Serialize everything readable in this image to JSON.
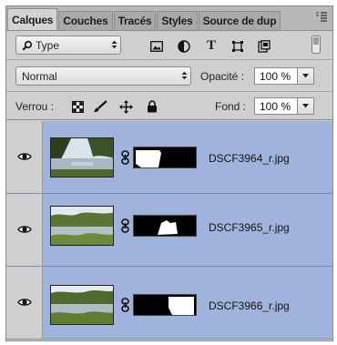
{
  "tabs": [
    {
      "label": "Calques",
      "active": true
    },
    {
      "label": "Couches"
    },
    {
      "label": "Tracés"
    },
    {
      "label": "Styles"
    },
    {
      "label": "Source de dup"
    }
  ],
  "tab_menu_icon": "panel-menu-icon",
  "filter": {
    "label": "Type",
    "icon": "search-icon"
  },
  "filter_icons": [
    "image-filter-icon",
    "adjustment-filter-icon",
    "type-filter-icon",
    "shape-filter-icon",
    "smart-object-filter-icon",
    "filter-toggle-icon"
  ],
  "type_glyph": "T",
  "blend_mode": "Normal",
  "opacity": {
    "label": "Opacité :",
    "value": "100 %"
  },
  "lock": {
    "label": "Verrou :",
    "icons": [
      "lock-transparent-icon",
      "lock-paint-icon",
      "lock-position-icon",
      "lock-all-icon"
    ]
  },
  "fill": {
    "label": "Fond :",
    "value": "100 %"
  },
  "layers": [
    {
      "name": "DSCF3964_r.jpg",
      "visible": true
    },
    {
      "name": "DSCF3965_r.jpg",
      "visible": true
    },
    {
      "name": "DSCF3966_r.jpg",
      "visible": true
    }
  ],
  "colors": {
    "selected_layer_bg": "#9fb3dc",
    "panel_bg": "#cfcfcf"
  }
}
